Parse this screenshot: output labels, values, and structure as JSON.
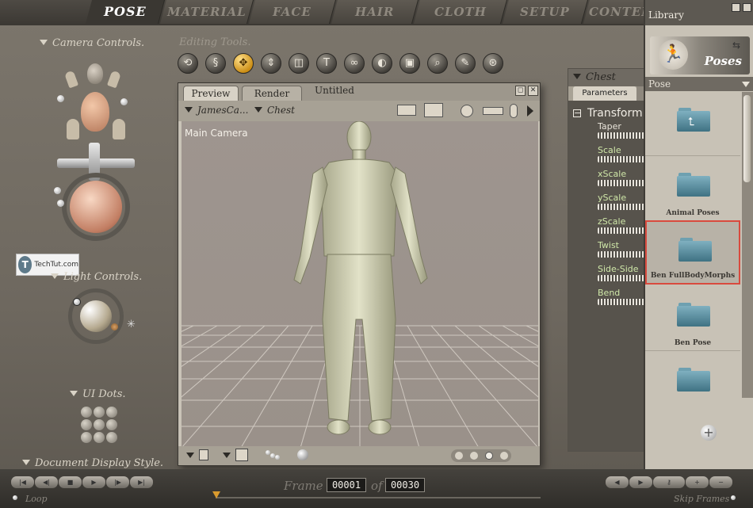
{
  "top_tabs": [
    "POSE",
    "MATERIAL",
    "FACE",
    "HAIR",
    "CLOTH",
    "SETUP",
    "CONTENT"
  ],
  "left": {
    "camera_controls": "Camera Controls.",
    "light_controls": "Light Controls.",
    "ui_dots": "UI Dots.",
    "document_display_style": "Document Display Style."
  },
  "watermark": {
    "logo": "T",
    "text": "TechTut.com"
  },
  "editing_tools": {
    "title": "Editing Tools.",
    "active_index": 2,
    "icons": [
      "rotate-icon",
      "twist-icon",
      "translate-icon",
      "translate-in-out-icon",
      "scale-icon",
      "taper-icon",
      "chain-break-icon",
      "color-icon",
      "grouping-icon",
      "view-magnifier-icon",
      "morph-brush-icon",
      "direct-manipulation-icon"
    ]
  },
  "document": {
    "tabs": [
      "Preview",
      "Render"
    ],
    "title": "Untitled",
    "figure_select": "JamesCa...",
    "part_select": "Chest",
    "viewport_label": "Main Camera"
  },
  "parameters": {
    "header": "Chest",
    "tab": "Parameters",
    "group": "Transform",
    "items": [
      "Taper",
      "Scale",
      "xScale",
      "yScale",
      "zScale",
      "Twist",
      "Side-Side",
      "Bend"
    ]
  },
  "library": {
    "title": "Library",
    "banner": "Poses",
    "category": "Pose",
    "items": [
      {
        "label": ""
      },
      {
        "label": "Animal Poses"
      },
      {
        "label": "Ben FullBodyMorphs",
        "selected": true
      },
      {
        "label": "Ben Pose"
      },
      {
        "label": ""
      }
    ]
  },
  "bottom": {
    "frame_label": "Frame",
    "current_frame": "00001",
    "of_label": "of",
    "total_frames": "00030",
    "loop": "Loop",
    "skip_frames": "Skip Frames"
  },
  "colors": {
    "accent": "#d99a2e",
    "selection": "#d94a3e",
    "folder": "#4f8496"
  }
}
